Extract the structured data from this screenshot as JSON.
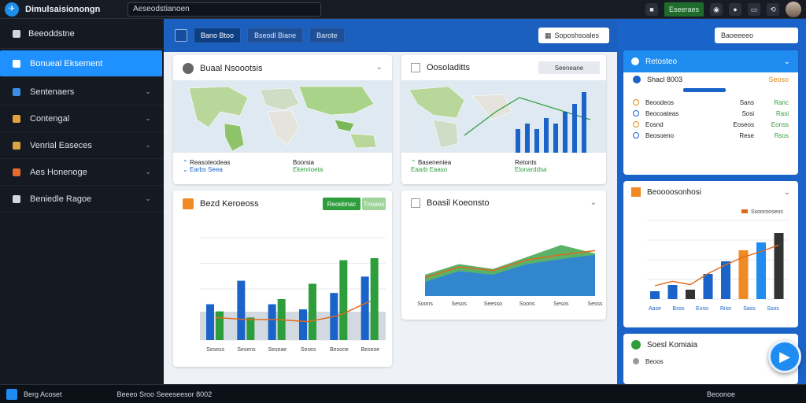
{
  "app": {
    "title": "Dimulsaisionongn",
    "search_value": "Aeseodstianoen"
  },
  "topbar": {
    "status_label": "Eseeraes"
  },
  "sidebar": {
    "header": "Beeoddstne",
    "items": [
      {
        "label": "Bonueal Eksement",
        "active": true,
        "icon": "square-icon",
        "color": "#ffffff"
      },
      {
        "label": "Sentenaers",
        "icon": "document-icon",
        "color": "#3a8ee6"
      },
      {
        "label": "Contengal",
        "icon": "shield-icon",
        "color": "#e6a23a"
      },
      {
        "label": "Venrial Easeces",
        "icon": "grid-icon",
        "color": "#d9a441"
      },
      {
        "label": "Aes Honenoge",
        "icon": "circle-icon",
        "color": "#e66b2f"
      },
      {
        "label": "Beniedle Ragoe",
        "icon": "list-icon",
        "color": "#cfd6df"
      }
    ]
  },
  "main": {
    "tabs": [
      "Bano Btoo",
      "Bseodl Biane",
      "Barote"
    ],
    "dropdown": "Soposhsoales"
  },
  "cards": {
    "map1": {
      "title": "Buaal Nsoootsis",
      "stat1_label": "Reasoteodeas",
      "stat1_value": "Earbs Seea",
      "stat2_label": "Boorsia",
      "stat2_value": "Ekenrioeta"
    },
    "map2": {
      "title": "Oosoladitts",
      "toggle": "Seeneane",
      "stat1_label": "Baseneniea",
      "stat1_value": "Eaarb Eaaso",
      "stat2_label": "Retonts",
      "stat2_value": "Elonarddsa"
    },
    "bar": {
      "title": "Bezd Keroeoss",
      "btn1": "Reoebnac",
      "btn2": "Tnoaes"
    },
    "area": {
      "title": "Boasil Koeonsto"
    }
  },
  "right": {
    "top": "Baoeeeeo",
    "card1": {
      "title": "Retosteo",
      "subtitle": "Shacl 8003",
      "sub_value": "Seoso",
      "rows": [
        {
          "label": "Beoodeos",
          "v1": "Sans",
          "v2": "Ranc"
        },
        {
          "label": "Beocoateas",
          "v1": "Sosi",
          "v2": "Rasi"
        },
        {
          "label": "Eosnd",
          "v1": "Eoseos",
          "v2": "Eonss"
        },
        {
          "label": "Beosoeno",
          "v1": "Rese",
          "v2": "Rsos"
        }
      ]
    },
    "card2": {
      "title": "Beoooosonhosi",
      "legend": "Ssoorooseos"
    },
    "card3": {
      "title": "Soesl Komiaia",
      "item": "Beoos"
    }
  },
  "statusbar": {
    "left": "Berg Acoset",
    "middle": "Beeeo Sroo Seeeseesor 8002",
    "right": "Beoonoe"
  },
  "chart_data": [
    {
      "type": "bar",
      "title": "",
      "categories": [
        "Sesess",
        "Sesens",
        "Seseae",
        "Seses",
        "Besone",
        "Beseoe"
      ],
      "series": [
        {
          "name": "",
          "values": [
            35,
            58,
            35,
            30,
            46,
            62
          ]
        },
        {
          "name": "",
          "values": [
            28,
            22,
            40,
            55,
            78,
            80
          ]
        }
      ],
      "line": [
        22,
        20,
        20,
        18,
        24,
        38
      ],
      "ylim": [
        0,
        100
      ]
    },
    {
      "type": "area",
      "title": "",
      "categories": [
        "Soons",
        "Sesos",
        "Seesso",
        "Soons",
        "Sesos",
        "Sesss"
      ],
      "series": [
        {
          "name": "",
          "values": [
            30,
            45,
            38,
            55,
            72,
            60
          ]
        },
        {
          "name": "",
          "values": [
            20,
            35,
            30,
            45,
            52,
            58
          ]
        }
      ],
      "ylim": [
        0,
        100
      ]
    },
    {
      "type": "bar",
      "title": "",
      "categories": [
        "Aase",
        "Bsss",
        "Eoso",
        "Riso",
        "Sass",
        "Ssos"
      ],
      "values": [
        10,
        18,
        12,
        32,
        48,
        62,
        72,
        84
      ],
      "ylim": [
        0,
        100
      ]
    }
  ]
}
